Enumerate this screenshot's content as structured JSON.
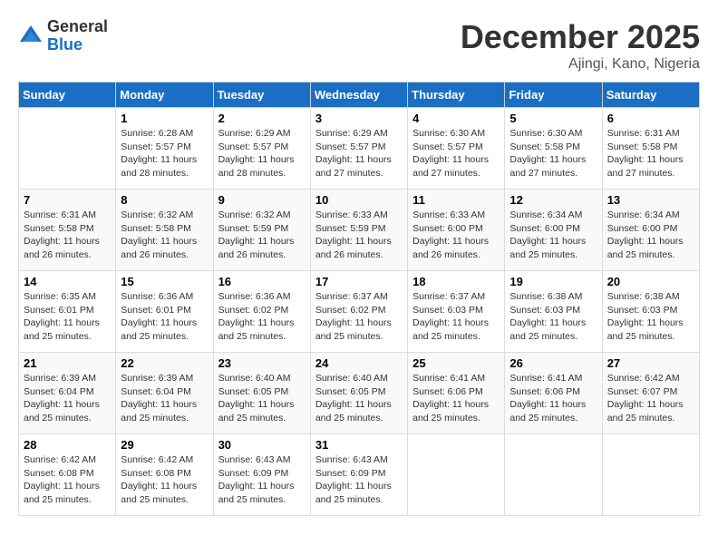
{
  "header": {
    "logo_general": "General",
    "logo_blue": "Blue",
    "title": "December 2025",
    "location": "Ajingi, Kano, Nigeria"
  },
  "days_of_week": [
    "Sunday",
    "Monday",
    "Tuesday",
    "Wednesday",
    "Thursday",
    "Friday",
    "Saturday"
  ],
  "weeks": [
    [
      {
        "day": "",
        "info": ""
      },
      {
        "day": "1",
        "info": "Sunrise: 6:28 AM\nSunset: 5:57 PM\nDaylight: 11 hours\nand 28 minutes."
      },
      {
        "day": "2",
        "info": "Sunrise: 6:29 AM\nSunset: 5:57 PM\nDaylight: 11 hours\nand 28 minutes."
      },
      {
        "day": "3",
        "info": "Sunrise: 6:29 AM\nSunset: 5:57 PM\nDaylight: 11 hours\nand 27 minutes."
      },
      {
        "day": "4",
        "info": "Sunrise: 6:30 AM\nSunset: 5:57 PM\nDaylight: 11 hours\nand 27 minutes."
      },
      {
        "day": "5",
        "info": "Sunrise: 6:30 AM\nSunset: 5:58 PM\nDaylight: 11 hours\nand 27 minutes."
      },
      {
        "day": "6",
        "info": "Sunrise: 6:31 AM\nSunset: 5:58 PM\nDaylight: 11 hours\nand 27 minutes."
      }
    ],
    [
      {
        "day": "7",
        "info": "Sunrise: 6:31 AM\nSunset: 5:58 PM\nDaylight: 11 hours\nand 26 minutes."
      },
      {
        "day": "8",
        "info": "Sunrise: 6:32 AM\nSunset: 5:58 PM\nDaylight: 11 hours\nand 26 minutes."
      },
      {
        "day": "9",
        "info": "Sunrise: 6:32 AM\nSunset: 5:59 PM\nDaylight: 11 hours\nand 26 minutes."
      },
      {
        "day": "10",
        "info": "Sunrise: 6:33 AM\nSunset: 5:59 PM\nDaylight: 11 hours\nand 26 minutes."
      },
      {
        "day": "11",
        "info": "Sunrise: 6:33 AM\nSunset: 6:00 PM\nDaylight: 11 hours\nand 26 minutes."
      },
      {
        "day": "12",
        "info": "Sunrise: 6:34 AM\nSunset: 6:00 PM\nDaylight: 11 hours\nand 25 minutes."
      },
      {
        "day": "13",
        "info": "Sunrise: 6:34 AM\nSunset: 6:00 PM\nDaylight: 11 hours\nand 25 minutes."
      }
    ],
    [
      {
        "day": "14",
        "info": "Sunrise: 6:35 AM\nSunset: 6:01 PM\nDaylight: 11 hours\nand 25 minutes."
      },
      {
        "day": "15",
        "info": "Sunrise: 6:36 AM\nSunset: 6:01 PM\nDaylight: 11 hours\nand 25 minutes."
      },
      {
        "day": "16",
        "info": "Sunrise: 6:36 AM\nSunset: 6:02 PM\nDaylight: 11 hours\nand 25 minutes."
      },
      {
        "day": "17",
        "info": "Sunrise: 6:37 AM\nSunset: 6:02 PM\nDaylight: 11 hours\nand 25 minutes."
      },
      {
        "day": "18",
        "info": "Sunrise: 6:37 AM\nSunset: 6:03 PM\nDaylight: 11 hours\nand 25 minutes."
      },
      {
        "day": "19",
        "info": "Sunrise: 6:38 AM\nSunset: 6:03 PM\nDaylight: 11 hours\nand 25 minutes."
      },
      {
        "day": "20",
        "info": "Sunrise: 6:38 AM\nSunset: 6:03 PM\nDaylight: 11 hours\nand 25 minutes."
      }
    ],
    [
      {
        "day": "21",
        "info": "Sunrise: 6:39 AM\nSunset: 6:04 PM\nDaylight: 11 hours\nand 25 minutes."
      },
      {
        "day": "22",
        "info": "Sunrise: 6:39 AM\nSunset: 6:04 PM\nDaylight: 11 hours\nand 25 minutes."
      },
      {
        "day": "23",
        "info": "Sunrise: 6:40 AM\nSunset: 6:05 PM\nDaylight: 11 hours\nand 25 minutes."
      },
      {
        "day": "24",
        "info": "Sunrise: 6:40 AM\nSunset: 6:05 PM\nDaylight: 11 hours\nand 25 minutes."
      },
      {
        "day": "25",
        "info": "Sunrise: 6:41 AM\nSunset: 6:06 PM\nDaylight: 11 hours\nand 25 minutes."
      },
      {
        "day": "26",
        "info": "Sunrise: 6:41 AM\nSunset: 6:06 PM\nDaylight: 11 hours\nand 25 minutes."
      },
      {
        "day": "27",
        "info": "Sunrise: 6:42 AM\nSunset: 6:07 PM\nDaylight: 11 hours\nand 25 minutes."
      }
    ],
    [
      {
        "day": "28",
        "info": "Sunrise: 6:42 AM\nSunset: 6:08 PM\nDaylight: 11 hours\nand 25 minutes."
      },
      {
        "day": "29",
        "info": "Sunrise: 6:42 AM\nSunset: 6:08 PM\nDaylight: 11 hours\nand 25 minutes."
      },
      {
        "day": "30",
        "info": "Sunrise: 6:43 AM\nSunset: 6:09 PM\nDaylight: 11 hours\nand 25 minutes."
      },
      {
        "day": "31",
        "info": "Sunrise: 6:43 AM\nSunset: 6:09 PM\nDaylight: 11 hours\nand 25 minutes."
      },
      {
        "day": "",
        "info": ""
      },
      {
        "day": "",
        "info": ""
      },
      {
        "day": "",
        "info": ""
      }
    ]
  ]
}
